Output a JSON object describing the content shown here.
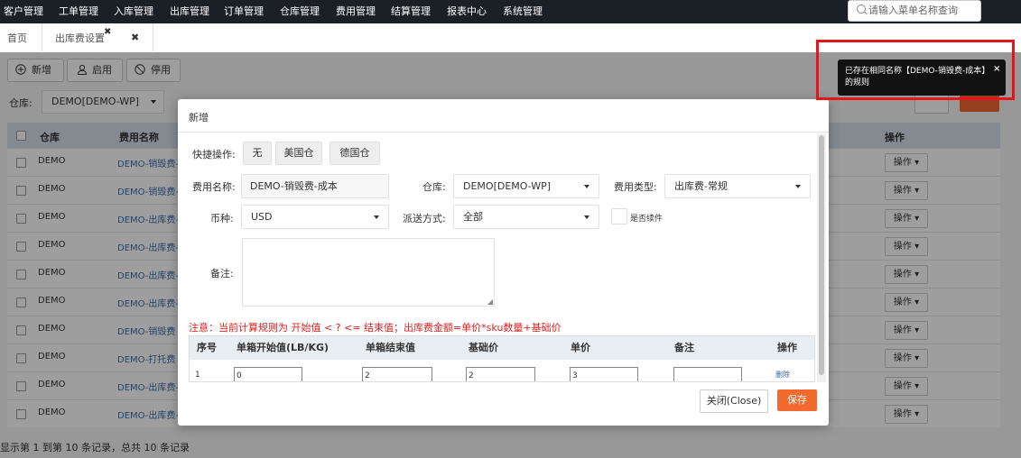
{
  "nav": {
    "items": [
      "客户管理",
      "工单管理",
      "入库管理",
      "出库管理",
      "订单管理",
      "仓库管理",
      "费用管理",
      "结算管理",
      "报表中心",
      "系统管理"
    ],
    "search_placeholder": "请输入菜单名称查询"
  },
  "tabs": {
    "home": "首页",
    "current": "出库费设置",
    "close": "✖",
    "close_all": "✖"
  },
  "toolbar": {
    "add": "新增",
    "enable": "启用",
    "disable": "停用"
  },
  "filter": {
    "warehouse_label": "仓库:",
    "warehouse_value": "DEMO[DEMO-WP]"
  },
  "grid": {
    "headers": {
      "warehouse": "仓库",
      "fee_name": "费用名称",
      "action": "操作"
    },
    "rows": [
      {
        "warehouse": "DEMO",
        "name": "DEMO-销毁费-成本"
      },
      {
        "warehouse": "DEMO",
        "name": "DEMO-销毁费-仓"
      },
      {
        "warehouse": "DEMO",
        "name": "DEMO-出库费-标"
      },
      {
        "warehouse": "DEMO",
        "name": "DEMO-出库费-按"
      },
      {
        "warehouse": "DEMO",
        "name": "DEMO-出库费-件"
      },
      {
        "warehouse": "DEMO",
        "name": "DEMO-出库费-箱"
      },
      {
        "warehouse": "DEMO",
        "name": "DEMO-销毁费"
      },
      {
        "warehouse": "DEMO",
        "name": "DEMO-打托费"
      },
      {
        "warehouse": "DEMO",
        "name": "DEMO-出库费-托"
      },
      {
        "warehouse": "DEMO",
        "name": "DEMO-出库费-标"
      }
    ],
    "action_label": "操作",
    "footer": "显示第 1 到第 10 条记录，总共 10 条记录"
  },
  "modal": {
    "title": "新增",
    "quick_label": "快捷操作:",
    "quick_buttons": [
      "无",
      "美国仓",
      "德国仓"
    ],
    "fee_name_label": "费用名称:",
    "fee_name_value": "DEMO-销毁费-成本",
    "warehouse_label": "仓库:",
    "warehouse_value": "DEMO[DEMO-WP]",
    "fee_type_label": "费用类型:",
    "fee_type_value": "出库费-常规",
    "currency_label": "币种:",
    "currency_value": "USD",
    "delivery_label": "派送方式:",
    "delivery_value": "全部",
    "continued_label": "是否续件",
    "remark_label": "备注:",
    "note": "注意：当前计算规则为 开始值 < ? <= 结束值；出库费金额=单价*sku数量+基础价",
    "table_headers": [
      "序号",
      "单箱开始值(LB/KG)",
      "单箱结束值",
      "基础价",
      "单价",
      "备注",
      "操作"
    ],
    "table_row": {
      "index": "1",
      "start": "0",
      "end": "2",
      "base": "2",
      "price": "3",
      "remark": "",
      "action": "删除"
    },
    "close_button": "关闭(Close)",
    "save_button": "保存"
  },
  "toast": {
    "message": "已存在相同名称【DEMO-销毁费-成本】的规则",
    "close": "×"
  },
  "colors": {
    "accent": "#f36a2f",
    "highlight": "#e8141c",
    "link": "#3c6aa8",
    "error": "#e02020"
  }
}
